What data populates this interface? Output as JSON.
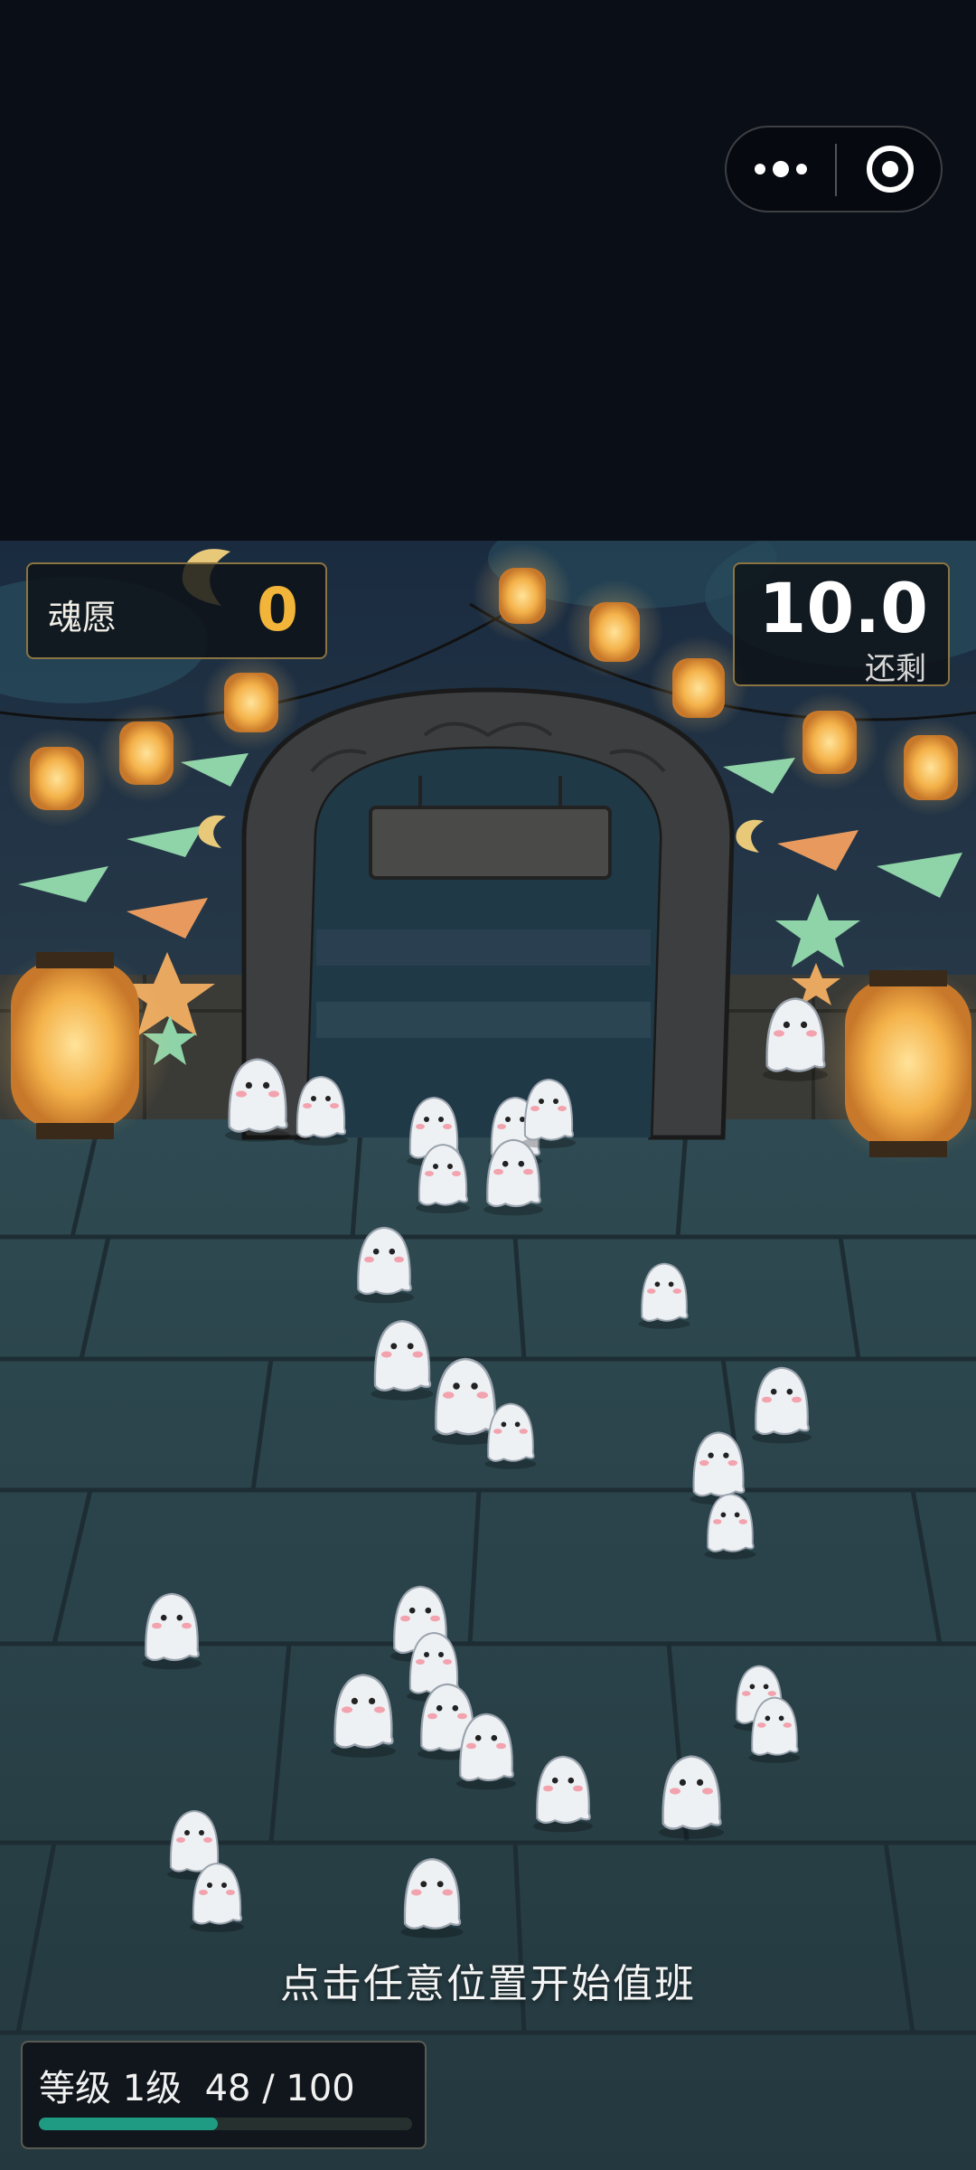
{
  "capsule": {
    "more_icon": "more-dots-icon",
    "close_icon": "target-close-icon"
  },
  "hud": {
    "soul_label": "魂愿",
    "soul_value": "0",
    "timer_value": "10.0",
    "timer_label": "还剩"
  },
  "hint": "点击任意位置开始值班",
  "level": {
    "text": "等级 1级  48 / 100",
    "current": 48,
    "max": 100,
    "bar_color": "#1f9a83"
  },
  "colors": {
    "accent": "#f2b53a",
    "scene_bg": "#1b2a33"
  }
}
